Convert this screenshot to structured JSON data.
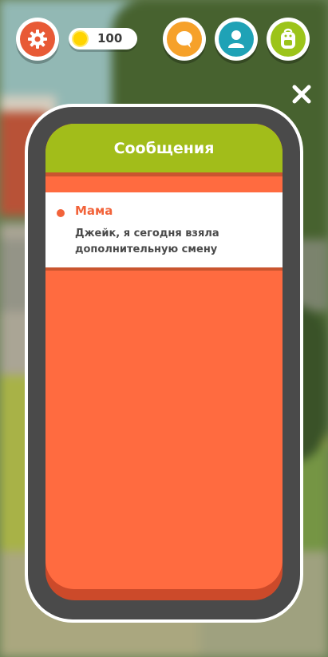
{
  "hud": {
    "coins": "100",
    "settings_icon": "gear-icon",
    "chat_icon": "speech-bubble-icon",
    "profile_icon": "person-icon",
    "bag_icon": "backpack-icon",
    "coin_icon": "coin-icon",
    "close_icon": "close-icon"
  },
  "phone": {
    "title": "Сообщения",
    "messages": [
      {
        "sender": "Мама",
        "text": "Джейк, я сегодня взяла дополнительную смену",
        "unread": true
      }
    ]
  },
  "colors": {
    "settings": "#e85a36",
    "chat": "#f6a12a",
    "profile": "#1fa2b6",
    "bag": "#9cc41a",
    "header": "#a2bd1a",
    "screen": "#ff6b40",
    "sender": "#f2633a"
  }
}
